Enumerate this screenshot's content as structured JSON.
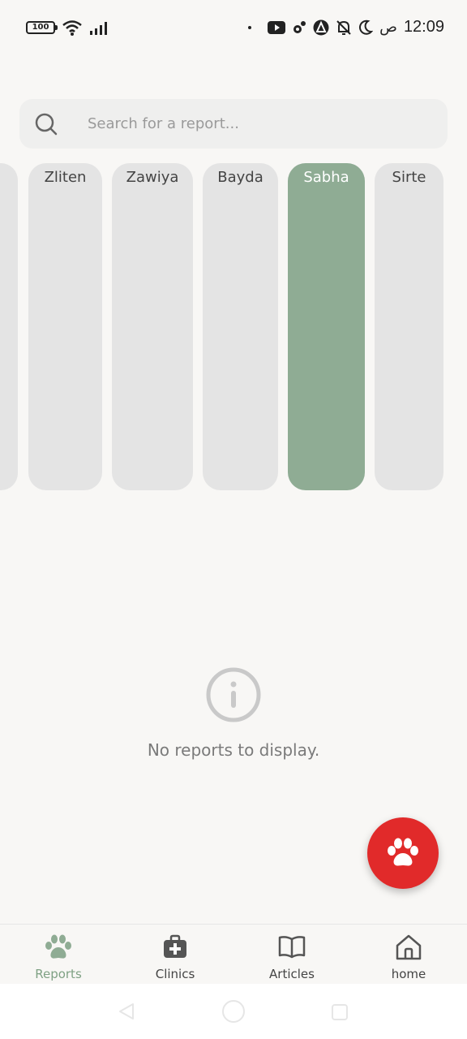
{
  "status_bar": {
    "battery": "100",
    "ampm": "ص",
    "time": "12:09"
  },
  "search": {
    "placeholder": "Search for a report..."
  },
  "cities": [
    {
      "label": ""
    },
    {
      "label": "Zliten"
    },
    {
      "label": "Zawiya"
    },
    {
      "label": "Bayda"
    },
    {
      "label": "Sabha",
      "active": true
    },
    {
      "label": "Sirte"
    }
  ],
  "empty_state": {
    "message": "No reports to display.",
    "icon": "info-icon"
  },
  "fab": {
    "icon": "paw-icon"
  },
  "nav": {
    "items": [
      {
        "label": "Reports",
        "icon": "paw-icon",
        "active": true
      },
      {
        "label": "Clinics",
        "icon": "medical-bag-icon"
      },
      {
        "label": "Articles",
        "icon": "book-icon"
      },
      {
        "label": "home",
        "icon": "home-icon"
      }
    ]
  },
  "colors": {
    "accent": "#8fac94",
    "fab": "#e12a2a",
    "background": "#f8f7f5",
    "card": "#e4e4e4"
  }
}
